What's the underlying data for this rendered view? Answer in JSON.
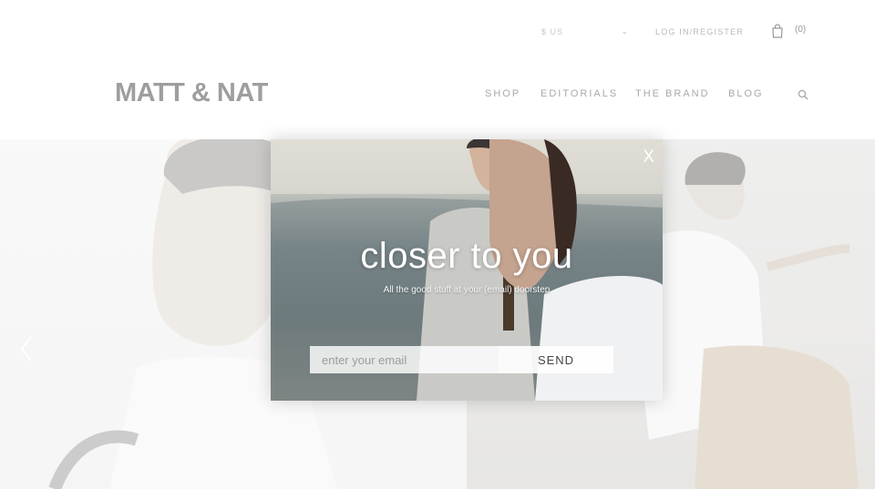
{
  "header": {
    "currency": "$ US",
    "login_label": "LOG IN/REGISTER",
    "cart_count": "(0)",
    "logo": "MATT & NAT",
    "nav": [
      {
        "label": "SHOP"
      },
      {
        "label": "EDITORIALS"
      },
      {
        "label": "THE BRAND"
      },
      {
        "label": "BLOG"
      }
    ],
    "icons": {
      "cart": "shopping-bag-icon",
      "search": "search-icon",
      "currency_toggle": "chevron-down-icon"
    }
  },
  "hero": {
    "prev_icon": "chevron-left-icon"
  },
  "newsletter_modal": {
    "close_label": "X",
    "title": "closer to you",
    "subtitle": "All the good stuff at your (email) doorstep",
    "email_placeholder": "enter your email",
    "send_label": "SEND"
  }
}
